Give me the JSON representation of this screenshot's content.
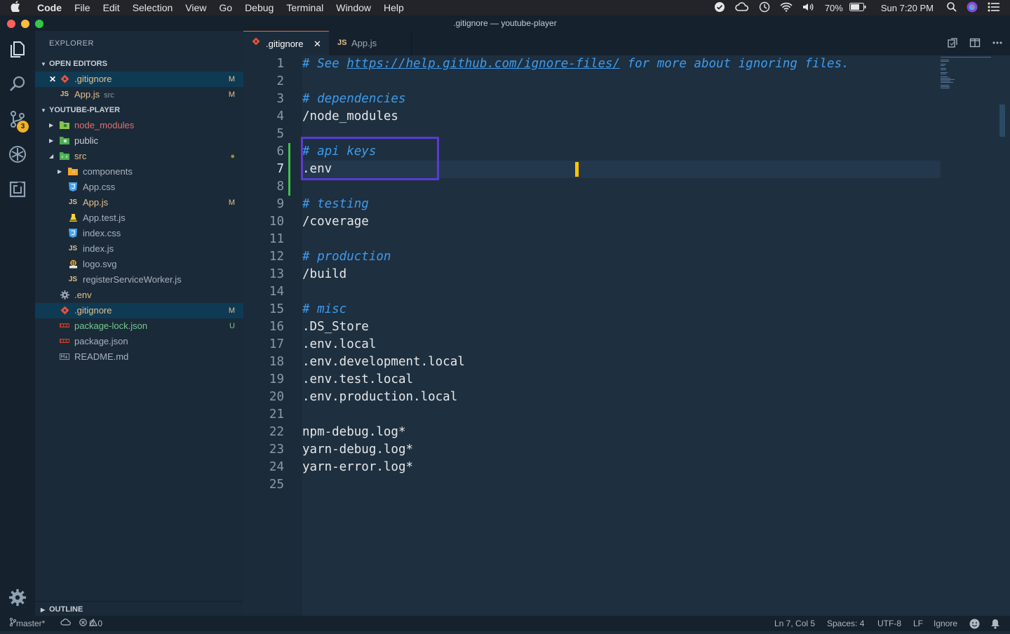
{
  "menubar": {
    "app_name": "Code",
    "items": [
      "File",
      "Edit",
      "Selection",
      "View",
      "Go",
      "Debug",
      "Terminal",
      "Window",
      "Help"
    ],
    "battery": "70%",
    "clock": "Sun 7:20 PM"
  },
  "window": {
    "title": ".gitignore — youtube-player"
  },
  "activity": {
    "scm_badge": "3"
  },
  "explorer": {
    "header": "EXPLORER",
    "open_editors_label": "OPEN EDITORS",
    "open_editors": [
      {
        "name": ".gitignore",
        "status": "M",
        "close": "✕"
      },
      {
        "name": "App.js",
        "sub": "src",
        "status": "M"
      }
    ],
    "project_label": "YOUTUBE-PLAYER",
    "tree": [
      {
        "name": "node_modules"
      },
      {
        "name": "public"
      },
      {
        "name": "src",
        "status": "●"
      },
      {
        "name": "components"
      },
      {
        "name": "App.css"
      },
      {
        "name": "App.js",
        "status": "M"
      },
      {
        "name": "App.test.js"
      },
      {
        "name": "index.css"
      },
      {
        "name": "index.js"
      },
      {
        "name": "logo.svg"
      },
      {
        "name": "registerServiceWorker.js"
      },
      {
        "name": ".env"
      },
      {
        "name": ".gitignore",
        "status": "M"
      },
      {
        "name": "package-lock.json",
        "status": "U"
      },
      {
        "name": "package.json"
      },
      {
        "name": "README.md"
      }
    ],
    "outline_label": "OUTLINE",
    "js_icon": "JS"
  },
  "tabs": [
    {
      "label": ".gitignore",
      "close": "✕"
    },
    {
      "label": "App.js",
      "icon": "JS"
    }
  ],
  "editor": {
    "cursor_line": 7,
    "lines": [
      {
        "n": "1",
        "pre": "# See ",
        "url": "https://help.github.com/ignore-files/",
        "post": " for more about ignoring files."
      },
      {
        "n": "2",
        "text": ""
      },
      {
        "n": "3",
        "comment": "# dependencies"
      },
      {
        "n": "4",
        "text": "/node_modules"
      },
      {
        "n": "5",
        "text": ""
      },
      {
        "n": "6",
        "comment": "# api keys"
      },
      {
        "n": "7",
        "text": ".env"
      },
      {
        "n": "8",
        "text": ""
      },
      {
        "n": "9",
        "comment": "# testing"
      },
      {
        "n": "10",
        "text": "/coverage"
      },
      {
        "n": "11",
        "text": ""
      },
      {
        "n": "12",
        "comment": "# production"
      },
      {
        "n": "13",
        "text": "/build"
      },
      {
        "n": "14",
        "text": ""
      },
      {
        "n": "15",
        "comment": "# misc"
      },
      {
        "n": "16",
        "text": ".DS_Store"
      },
      {
        "n": "17",
        "text": ".env.local"
      },
      {
        "n": "18",
        "text": ".env.development.local"
      },
      {
        "n": "19",
        "text": ".env.test.local"
      },
      {
        "n": "20",
        "text": ".env.production.local"
      },
      {
        "n": "21",
        "text": ""
      },
      {
        "n": "22",
        "text": "npm-debug.log*"
      },
      {
        "n": "23",
        "text": "yarn-debug.log*"
      },
      {
        "n": "24",
        "text": "yarn-error.log*"
      },
      {
        "n": "25",
        "text": ""
      }
    ]
  },
  "status": {
    "branch": "master*",
    "errors": "0",
    "warnings": "0",
    "position": "Ln 7, Col 5",
    "spaces": "Spaces: 4",
    "encoding": "UTF-8",
    "eol": "LF",
    "language": "Ignore"
  },
  "colors": {
    "comment": "#3f9bec",
    "cursor": "#ffc600",
    "highlight_box": "#5b3ad4",
    "git_modified": "#e2c08d",
    "git_untracked": "#73c991"
  }
}
